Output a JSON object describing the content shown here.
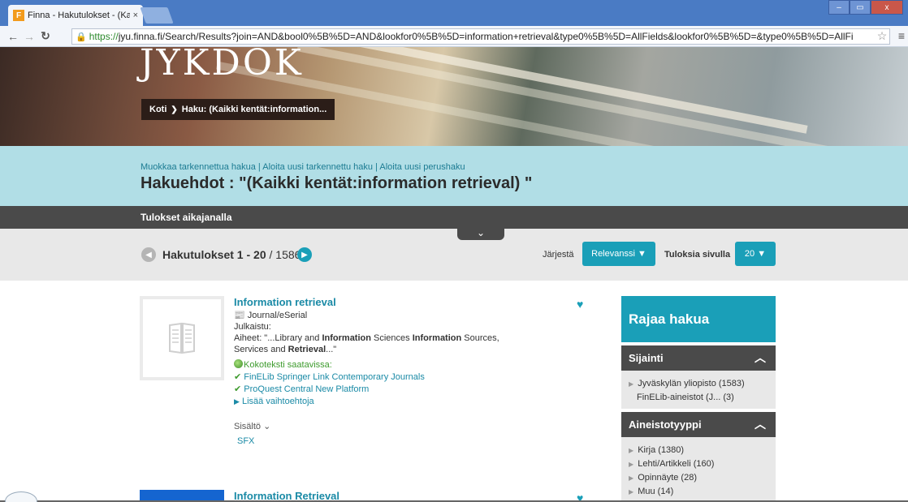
{
  "browser": {
    "tab_title": "Finna - Hakutulokset - (Ka",
    "tab_close": "×",
    "favicon_letter": "F",
    "url_https": "https://",
    "url_rest": "jyu.finna.fi/Search/Results?join=AND&bool0%5B%5D=AND&lookfor0%5B%5D=information+retrieval&type0%5B%5D=AllFields&lookfor0%5B%5D=&type0%5B%5D=AllFi",
    "win_min": "–",
    "win_max": "▭",
    "win_close": "x"
  },
  "hero": {
    "title": "JYKDOK",
    "breadcrumb_home": "Koti",
    "breadcrumb_sep": "❯",
    "breadcrumb_current": "Haku: (Kaikki kentät:information..."
  },
  "search": {
    "link_edit": "Muokkaa tarkennettua hakua",
    "link_new_advanced": "Aloita uusi tarkennettu haku",
    "link_new_basic": "Aloita uusi perushaku",
    "separator": " | ",
    "title": "Hakuehdot : \"(Kaikki kentät:information retrieval) \""
  },
  "timeline": {
    "label": "Tulokset aikajanalla",
    "toggle": "⌄"
  },
  "results_bar": {
    "range": "Hakutulokset 1 - 20",
    "total": " / 1586",
    "sort_label": "Järjestä",
    "sort_value": "Relevanssi ▼",
    "perpage_label": "Tuloksia sivulla",
    "perpage_value": "20 ▼"
  },
  "records": [
    {
      "title": "Information retrieval",
      "format": "Journal/eSerial",
      "published": "Julkaistu:",
      "subjects_prefix": "Aiheet: \"...Library and ",
      "subjects_b1": "Information",
      "subjects_mid1": " Sciences ",
      "subjects_b2": "Information",
      "subjects_mid2": " Sources, Services and ",
      "subjects_b3": "Retrieval",
      "subjects_suffix": "...\"",
      "fulltext": "Kokoteksti saatavissa:",
      "link1": "FinELib Springer Link Contemporary Journals",
      "link2": "ProQuest Central New Platform",
      "more": "Lisää vaihtoehtoja",
      "content_label": "Sisältö ⌄",
      "sfx": "SFX"
    },
    {
      "title": "Information Retrieval"
    }
  ],
  "facets": {
    "header": "Rajaa hakua",
    "location_title": "Sijainti",
    "location_items": [
      "Jyväskylän yliopisto (1583)",
      "FinELib-aineistot (J...  (3)"
    ],
    "type_title": "Aineistotyyppi",
    "type_items": [
      "Kirja (1380)",
      "Lehti/Artikkeli (160)",
      "Opinnäyte (28)",
      "Muu (14)"
    ]
  },
  "colors": {
    "accent": "#1a9fb8",
    "header_band": "#b1dee6",
    "dark_band": "#4a4a4a"
  }
}
